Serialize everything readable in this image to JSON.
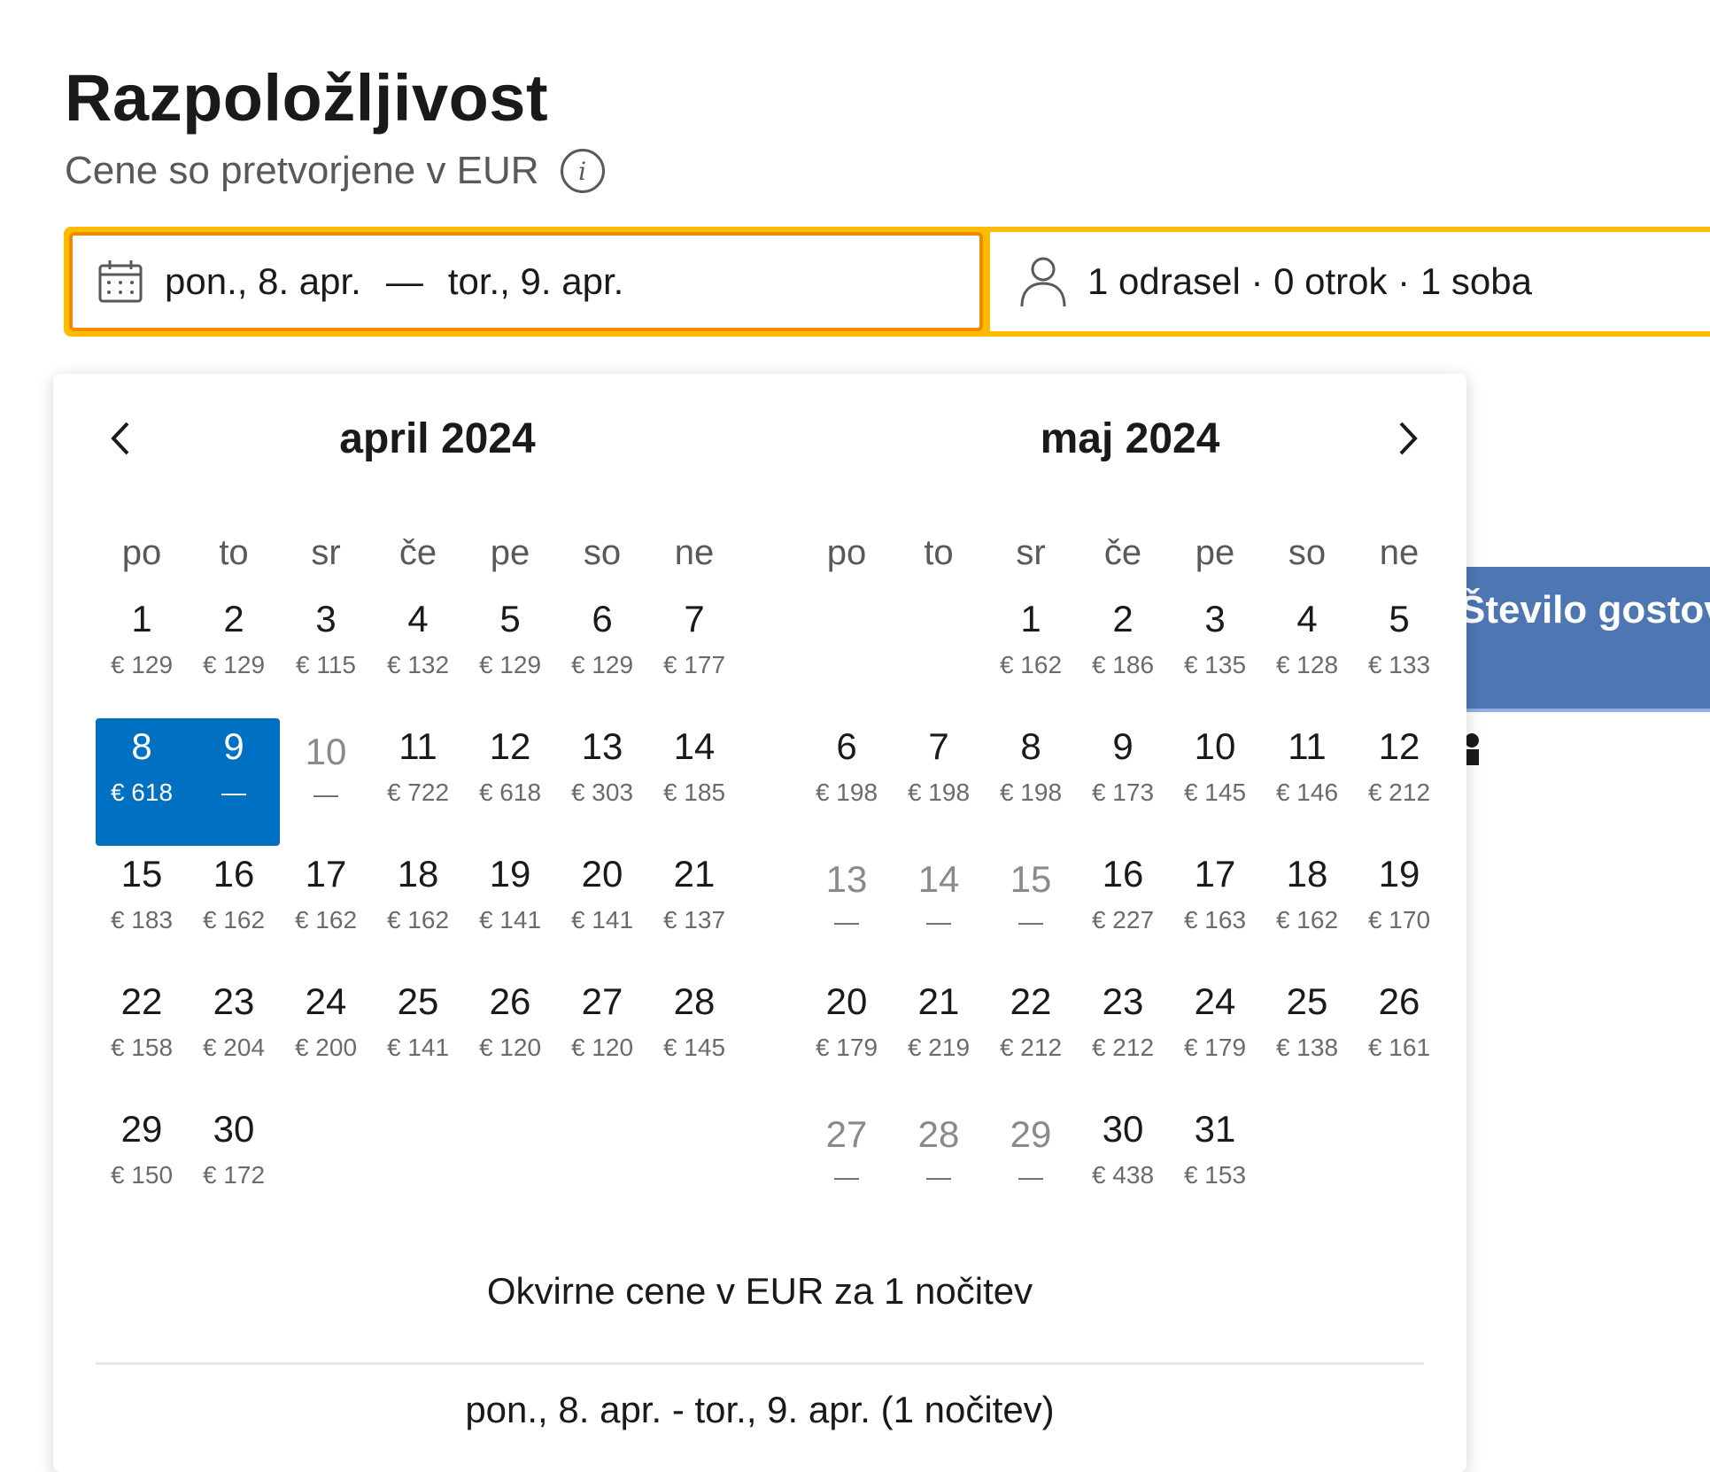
{
  "header": {
    "title": "Razpoložljivost",
    "subtitle": "Cene so pretvorjene v EUR"
  },
  "search": {
    "checkin": "pon., 8. apr.",
    "separator": "—",
    "checkout": "tor., 9. apr.",
    "guests": "1 odrasel · 0 otrok · 1 soba"
  },
  "side_panel": {
    "label": "Število gostov"
  },
  "calendar": {
    "weekdays": [
      "po",
      "to",
      "sr",
      "če",
      "pe",
      "so",
      "ne"
    ],
    "months": [
      {
        "title": "april 2024",
        "offset": 0,
        "days": [
          {
            "d": "1",
            "p": "€ 129"
          },
          {
            "d": "2",
            "p": "€ 129"
          },
          {
            "d": "3",
            "p": "€ 115"
          },
          {
            "d": "4",
            "p": "€ 132"
          },
          {
            "d": "5",
            "p": "€ 129"
          },
          {
            "d": "6",
            "p": "€ 129"
          },
          {
            "d": "7",
            "p": "€ 177"
          },
          {
            "d": "8",
            "p": "€ 618",
            "state": "start"
          },
          {
            "d": "9",
            "p": "—",
            "state": "end"
          },
          {
            "d": "10",
            "p": "—",
            "state": "disabled"
          },
          {
            "d": "11",
            "p": "€ 722"
          },
          {
            "d": "12",
            "p": "€ 618"
          },
          {
            "d": "13",
            "p": "€ 303"
          },
          {
            "d": "14",
            "p": "€ 185"
          },
          {
            "d": "15",
            "p": "€ 183"
          },
          {
            "d": "16",
            "p": "€ 162"
          },
          {
            "d": "17",
            "p": "€ 162"
          },
          {
            "d": "18",
            "p": "€ 162"
          },
          {
            "d": "19",
            "p": "€ 141"
          },
          {
            "d": "20",
            "p": "€ 141"
          },
          {
            "d": "21",
            "p": "€ 137"
          },
          {
            "d": "22",
            "p": "€ 158"
          },
          {
            "d": "23",
            "p": "€ 204"
          },
          {
            "d": "24",
            "p": "€ 200"
          },
          {
            "d": "25",
            "p": "€ 141"
          },
          {
            "d": "26",
            "p": "€ 120"
          },
          {
            "d": "27",
            "p": "€ 120"
          },
          {
            "d": "28",
            "p": "€ 145"
          },
          {
            "d": "29",
            "p": "€ 150"
          },
          {
            "d": "30",
            "p": "€ 172"
          }
        ]
      },
      {
        "title": "maj 2024",
        "offset": 2,
        "days": [
          {
            "d": "1",
            "p": "€ 162"
          },
          {
            "d": "2",
            "p": "€ 186"
          },
          {
            "d": "3",
            "p": "€ 135"
          },
          {
            "d": "4",
            "p": "€ 128"
          },
          {
            "d": "5",
            "p": "€ 133"
          },
          {
            "d": "6",
            "p": "€ 198"
          },
          {
            "d": "7",
            "p": "€ 198"
          },
          {
            "d": "8",
            "p": "€ 198"
          },
          {
            "d": "9",
            "p": "€ 173"
          },
          {
            "d": "10",
            "p": "€ 145"
          },
          {
            "d": "11",
            "p": "€ 146"
          },
          {
            "d": "12",
            "p": "€ 212"
          },
          {
            "d": "13",
            "p": "—",
            "state": "disabled"
          },
          {
            "d": "14",
            "p": "—",
            "state": "disabled"
          },
          {
            "d": "15",
            "p": "—",
            "state": "disabled"
          },
          {
            "d": "16",
            "p": "€ 227"
          },
          {
            "d": "17",
            "p": "€ 163"
          },
          {
            "d": "18",
            "p": "€ 162"
          },
          {
            "d": "19",
            "p": "€ 170"
          },
          {
            "d": "20",
            "p": "€ 179"
          },
          {
            "d": "21",
            "p": "€ 219"
          },
          {
            "d": "22",
            "p": "€ 212"
          },
          {
            "d": "23",
            "p": "€ 212"
          },
          {
            "d": "24",
            "p": "€ 179"
          },
          {
            "d": "25",
            "p": "€ 138"
          },
          {
            "d": "26",
            "p": "€ 161"
          },
          {
            "d": "27",
            "p": "—",
            "state": "disabled"
          },
          {
            "d": "28",
            "p": "—",
            "state": "disabled"
          },
          {
            "d": "29",
            "p": "—",
            "state": "disabled"
          },
          {
            "d": "30",
            "p": "€ 438"
          },
          {
            "d": "31",
            "p": "€ 153"
          }
        ]
      }
    ],
    "legend": "Okvirne cene v EUR za 1 nočitev",
    "summary": "pon., 8. apr. - tor., 9. apr. (1 nočitev)",
    "icons": {
      "prev": "chevron-left-icon",
      "next": "chevron-right-icon"
    },
    "colors": {
      "selected": "#0071c2",
      "searchbar": "#febb02",
      "active_border": "#f08a00"
    }
  }
}
